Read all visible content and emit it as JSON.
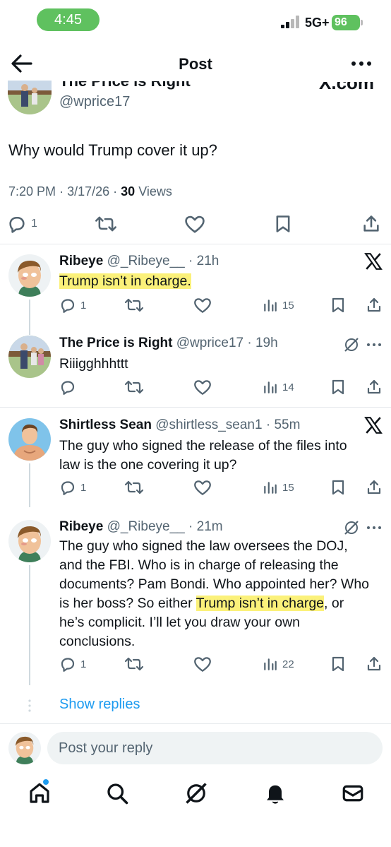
{
  "status_bar": {
    "time": "4:45",
    "network": "5G+",
    "battery": "96"
  },
  "header": {
    "title": "Post"
  },
  "main_post": {
    "author_name": "The Price is Right",
    "handle": "@wprice17",
    "watermark": "X.com",
    "text": "Why would Trump cover it up?",
    "time": "7:20 PM",
    "date": "3/17/26",
    "views_count": "30",
    "views_label": "Views",
    "replies": "1"
  },
  "replies": [
    {
      "name": "Ribeye",
      "handle": "@_Ribeye__",
      "time": "21h",
      "text": "Trump isn’t in charge.",
      "replies": "1",
      "views": "15",
      "corner_icon": "x-logo-icon"
    },
    {
      "name": "The Price is Right",
      "handle": "@wprice17",
      "time": "19h",
      "text": "Riiigghhhttt",
      "replies": "",
      "views": "14",
      "corner_icon": "grok-icon"
    },
    {
      "name": "Shirtless Sean",
      "handle": "@shirtless_sean1",
      "time": "55m",
      "text": "The guy who signed the release of the files into law is the one covering it up?",
      "replies": "1",
      "views": "15",
      "corner_icon": "x-logo-icon"
    },
    {
      "name": "Ribeye",
      "handle": "@_Ribeye__",
      "time": "21m",
      "text_before": "The guy who signed the law oversees the DOJ, and the FBI. Who is in charge of releasing the documents? Pam Bondi. Who appointed her? Who is her boss? So either ",
      "text_highlight": "Trump isn’t in charge",
      "text_after": ", or he’s complicit. I’ll let you draw your own conclusions.",
      "replies": "1",
      "views": "22",
      "corner_icon": "grok-icon"
    }
  ],
  "show_replies": "Show replies",
  "composer": {
    "placeholder": "Post your reply"
  },
  "tabbar": [
    "home-icon",
    "search-icon",
    "grok-icon",
    "notifications-icon",
    "messages-icon"
  ],
  "colors": {
    "accent": "#1d9bf0",
    "highlight": "#fbf17a",
    "status_green": "#5fc15f",
    "muted": "#536471"
  }
}
